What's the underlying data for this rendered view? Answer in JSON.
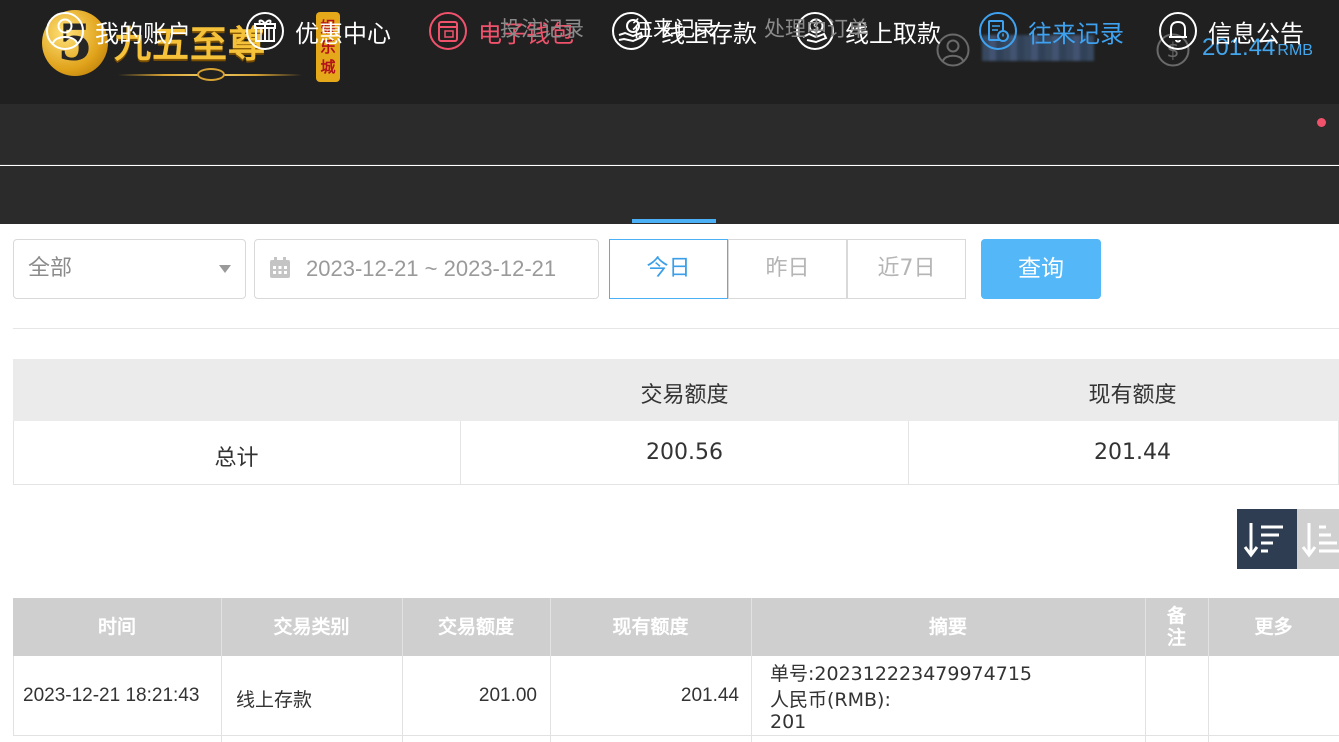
{
  "header": {
    "logo": {
      "digit": "5",
      "text": "九五至尊",
      "badge": [
        "娱",
        "乐",
        "城"
      ]
    },
    "balance": {
      "amount": "201.44",
      "unit": "RMB"
    },
    "colors": {
      "accent": "#43a6ec",
      "danger": "#f0526c",
      "dark": "#202020"
    }
  },
  "main_nav": [
    {
      "label": "我的账户",
      "icon": "user-icon",
      "state": "normal"
    },
    {
      "label": "优惠中心",
      "icon": "gift-icon",
      "state": "normal"
    },
    {
      "label": "电子钱包",
      "icon": "wallet-icon",
      "state": "red"
    },
    {
      "label": "线上存款",
      "icon": "deposit-icon",
      "state": "normal"
    },
    {
      "label": "线上取款",
      "icon": "withdraw-icon",
      "state": "normal"
    },
    {
      "label": "往来记录",
      "icon": "records-icon",
      "state": "active"
    },
    {
      "label": "信息公告",
      "icon": "bell-icon",
      "state": "normal",
      "has_dot": true
    }
  ],
  "sub_nav": [
    {
      "label": "投注记录",
      "active": false
    },
    {
      "label": "往来记录",
      "active": true
    },
    {
      "label": "处理中订单",
      "active": false
    }
  ],
  "filters": {
    "type_select": "全部",
    "date_range": "2023-12-21 ~ 2023-12-21",
    "ranges": [
      {
        "label": "今日",
        "active": true
      },
      {
        "label": "昨日",
        "active": false
      },
      {
        "label": "近7日",
        "active": false
      }
    ],
    "query_label": "查询"
  },
  "summary": {
    "headers": [
      "",
      "交易额度",
      "现有额度"
    ],
    "row": {
      "label": "总计",
      "transaction_amount": "200.56",
      "current_amount": "201.44"
    }
  },
  "records": {
    "headers": [
      "时间",
      "交易类别",
      "交易额度",
      "现有额度",
      "摘要",
      "备注",
      "更多"
    ],
    "rows": [
      {
        "time": "2023-12-21 18:21:43",
        "category": "线上存款",
        "amount": "201.00",
        "balance": "201.44",
        "memo": [
          "单号:202312223479974715",
          "人民币(RMB):",
          "201"
        ],
        "note": "",
        "more": ""
      }
    ]
  }
}
